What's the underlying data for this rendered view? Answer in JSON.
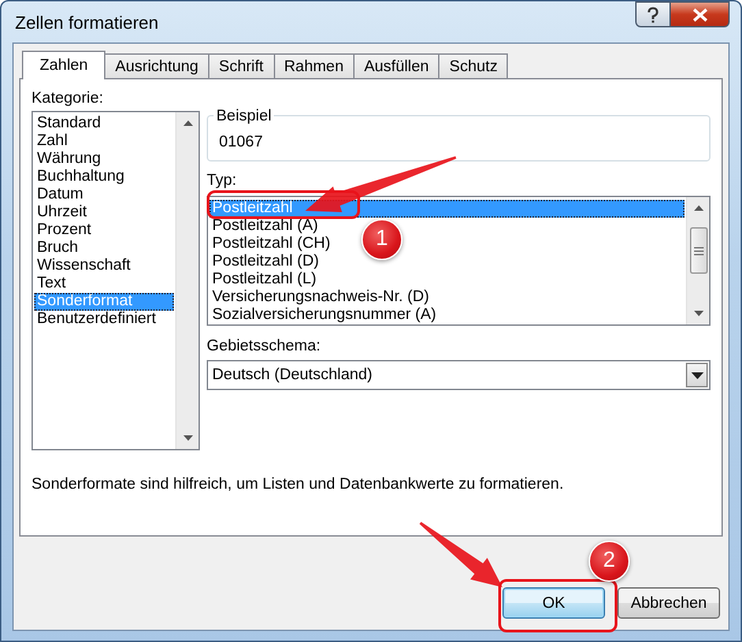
{
  "window": {
    "title": "Zellen formatieren"
  },
  "tabs": [
    {
      "label": "Zahlen",
      "selected": true
    },
    {
      "label": "Ausrichtung",
      "selected": false
    },
    {
      "label": "Schrift",
      "selected": false
    },
    {
      "label": "Rahmen",
      "selected": false
    },
    {
      "label": "Ausfüllen",
      "selected": false
    },
    {
      "label": "Schutz",
      "selected": false
    }
  ],
  "category": {
    "label": "Kategorie:",
    "items": [
      {
        "label": "Standard",
        "selected": false
      },
      {
        "label": "Zahl",
        "selected": false
      },
      {
        "label": "Währung",
        "selected": false
      },
      {
        "label": "Buchhaltung",
        "selected": false
      },
      {
        "label": "Datum",
        "selected": false
      },
      {
        "label": "Uhrzeit",
        "selected": false
      },
      {
        "label": "Prozent",
        "selected": false
      },
      {
        "label": "Bruch",
        "selected": false
      },
      {
        "label": "Wissenschaft",
        "selected": false
      },
      {
        "label": "Text",
        "selected": false
      },
      {
        "label": "Sonderformat",
        "selected": true
      },
      {
        "label": "Benutzerdefiniert",
        "selected": false
      }
    ]
  },
  "sample": {
    "label": "Beispiel",
    "value": "01067"
  },
  "type": {
    "label": "Typ:",
    "items": [
      {
        "label": "Postleitzahl",
        "selected": true
      },
      {
        "label": "Postleitzahl (A)",
        "selected": false
      },
      {
        "label": "Postleitzahl (CH)",
        "selected": false
      },
      {
        "label": "Postleitzahl (D)",
        "selected": false
      },
      {
        "label": "Postleitzahl (L)",
        "selected": false
      },
      {
        "label": "Versicherungsnachweis-Nr. (D)",
        "selected": false
      },
      {
        "label": "Sozialversicherungsnummer (A)",
        "selected": false
      }
    ]
  },
  "locale": {
    "label": "Gebietsschema:",
    "value": "Deutsch (Deutschland)"
  },
  "description": "Sonderformate sind hilfreich, um Listen und Datenbankwerte zu formatieren.",
  "buttons": [
    {
      "label": "OK",
      "kind": "default"
    },
    {
      "label": "Abbrechen",
      "kind": "normal"
    }
  ],
  "annotations": [
    {
      "label": "1"
    },
    {
      "label": "2"
    }
  ]
}
